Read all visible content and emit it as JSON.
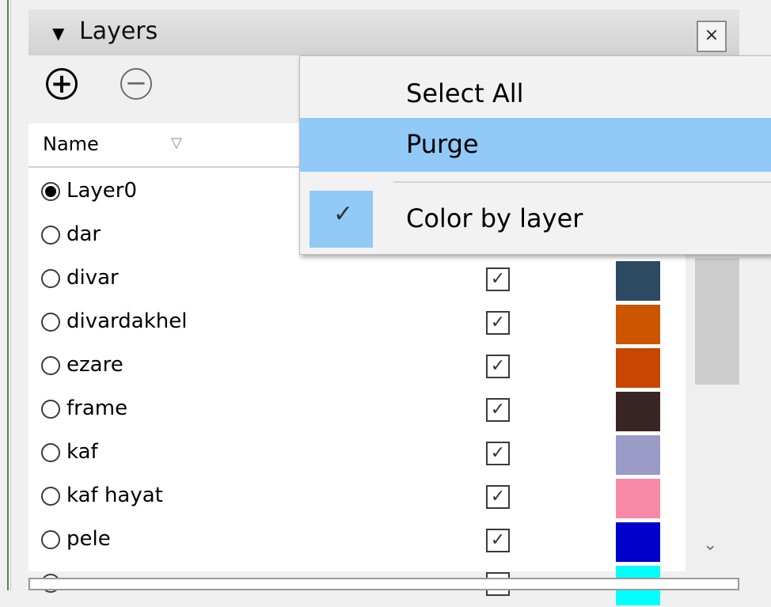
{
  "panel": {
    "title": "Layers",
    "collapse_icon": "triangle-down-icon",
    "close_label": "×"
  },
  "toolbar": {
    "add_icon": "plus-circle-icon",
    "add_glyph": "+",
    "remove_icon": "minus-circle-icon",
    "remove_glyph": "−"
  },
  "table": {
    "header_name": "Name",
    "sort_glyph": "▽"
  },
  "layers": [
    {
      "name": "Layer0",
      "active": true,
      "visible": null,
      "color": null
    },
    {
      "name": "dar",
      "active": false,
      "visible": null,
      "color": null
    },
    {
      "name": "divar",
      "active": false,
      "visible": true,
      "color": "#2e4a63"
    },
    {
      "name": "divardakhel",
      "active": false,
      "visible": true,
      "color": "#cc5500"
    },
    {
      "name": "ezare",
      "active": false,
      "visible": true,
      "color": "#c94600"
    },
    {
      "name": "frame",
      "active": false,
      "visible": true,
      "color": "#3a2525"
    },
    {
      "name": "kaf",
      "active": false,
      "visible": true,
      "color": "#9b9bc8"
    },
    {
      "name": "kaf hayat",
      "active": false,
      "visible": true,
      "color": "#f889a6"
    },
    {
      "name": "pele",
      "active": false,
      "visible": true,
      "color": "#0000cc"
    },
    {
      "name": "",
      "active": false,
      "visible": true,
      "color": "#00ffff"
    }
  ],
  "context_menu": {
    "items": [
      {
        "label": "Select All",
        "highlighted": false
      },
      {
        "label": "Purge",
        "highlighted": true
      },
      {
        "label": "Color by layer",
        "checked": true
      }
    ],
    "check_glyph": "✓"
  },
  "scrollbar": {
    "down_glyph": "⌄"
  },
  "colors": {
    "menu_highlight": "#91c9f7",
    "rail_accent": "#4e8a4a"
  }
}
